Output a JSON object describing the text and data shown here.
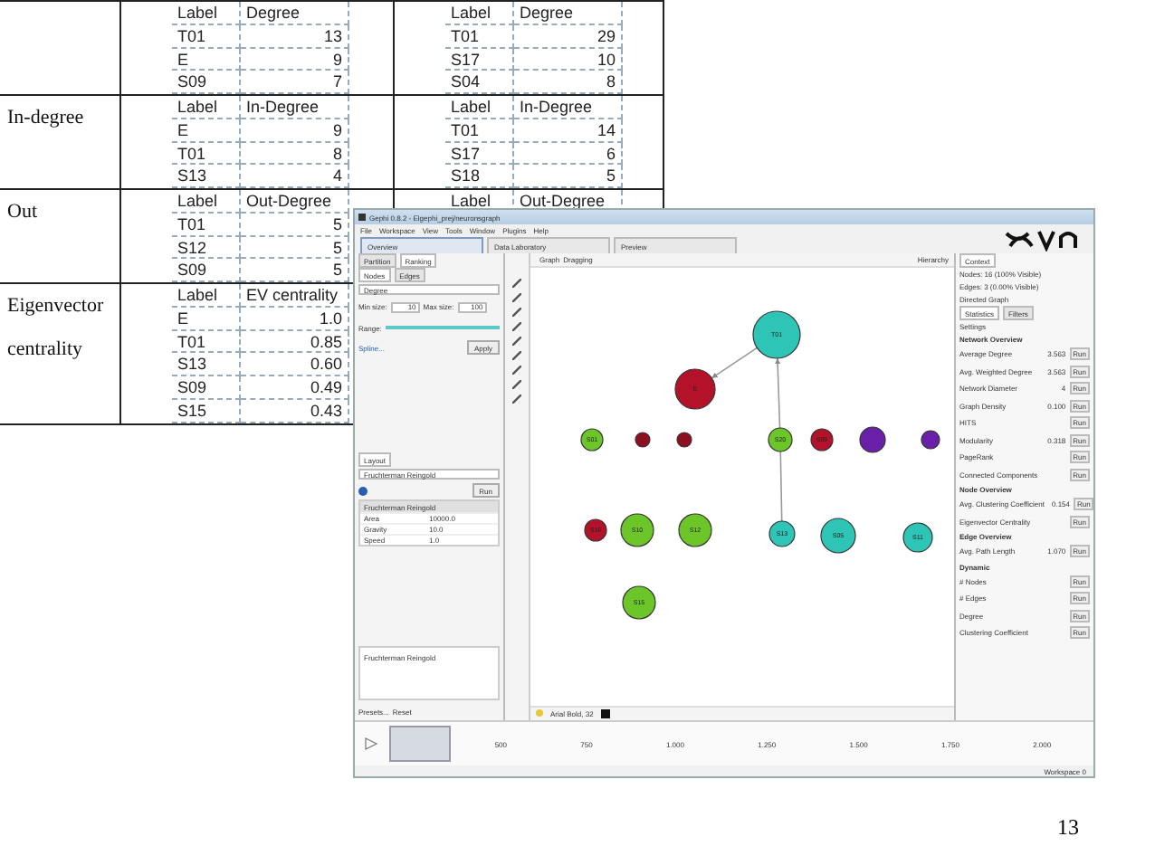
{
  "table": {
    "rows": [
      {
        "left": {
          "columns": [
            "Label",
            "Degree"
          ],
          "rows": [
            [
              "T01",
              "13"
            ],
            [
              "E",
              "9"
            ],
            [
              "S09",
              "7"
            ]
          ]
        },
        "right": {
          "columns": [
            "Label",
            "Degree"
          ],
          "rows": [
            [
              "T01",
              "29"
            ],
            [
              "S17",
              "10"
            ],
            [
              "S04",
              "8"
            ]
          ]
        }
      },
      {
        "metric": "In-degree",
        "left": {
          "columns": [
            "Label",
            "In-Degree"
          ],
          "rows": [
            [
              "E",
              "9"
            ],
            [
              "T01",
              "8"
            ],
            [
              "S13",
              "4"
            ]
          ]
        },
        "right": {
          "columns": [
            "Label",
            "In-Degree"
          ],
          "rows": [
            [
              "T01",
              "14"
            ],
            [
              "S17",
              "6"
            ],
            [
              "S18",
              "5"
            ]
          ]
        }
      },
      {
        "metric": "Out",
        "left": {
          "columns": [
            "Label",
            "Out-Degree"
          ],
          "rows": [
            [
              "T01",
              "5"
            ],
            [
              "S12",
              "5"
            ],
            [
              "S09",
              "5"
            ]
          ]
        },
        "right": {
          "columns": [
            "Label",
            "Out-Degree"
          ]
        }
      },
      {
        "metric": "Eigenvector centrality",
        "left": {
          "columns": [
            "Label",
            "EV centrality"
          ],
          "rows": [
            [
              "E",
              "1.0"
            ],
            [
              "T01",
              "0.85"
            ],
            [
              "S13",
              "0.60"
            ],
            [
              "S09",
              "0.49"
            ],
            [
              "S15",
              "0.43"
            ]
          ]
        }
      }
    ]
  },
  "gephi": {
    "title": "Gephi 0.8.2 - Elgephi_prej/neuronsgraph",
    "menu": [
      "File",
      "Workspace",
      "View",
      "Tools",
      "Window",
      "Plugins",
      "Help"
    ],
    "tabs": [
      {
        "label": "Overview",
        "selected": true
      },
      {
        "label": "Data Laboratory",
        "selected": false
      },
      {
        "label": "Preview",
        "selected": false
      }
    ],
    "left_panel": {
      "tabs": [
        {
          "label": "Partition",
          "selected": false
        },
        {
          "label": "Ranking",
          "selected": true
        }
      ],
      "subtabs": [
        {
          "label": "Nodes",
          "selected": true
        },
        {
          "label": "Edges",
          "selected": false
        }
      ],
      "parameter": "Degree",
      "min_label": "Min size:",
      "min_value": "10",
      "max_label": "Max size:",
      "max_value": "100",
      "range_label": "Range:",
      "range": {
        "level": 1
      },
      "spline": "Spline...",
      "apply": "Apply",
      "layout_tab": "Layout",
      "layout_algorithm": "Fruchterman Reingold",
      "run": "Run",
      "properties_title": "Fruchterman Reingold",
      "properties": [
        {
          "name": "Area",
          "value": "10000.0"
        },
        {
          "name": "Gravity",
          "value": "10.0"
        },
        {
          "name": "Speed",
          "value": "1.0"
        }
      ],
      "description_title": "Fruchterman Reingold",
      "presets": "Presets...",
      "reset": "Reset"
    },
    "graph": {
      "tab": "Graph",
      "mode": "Dragging",
      "hierarchy": "Hierarchy",
      "font": "Arial Bold, 32",
      "nodes": [
        {
          "label": "T01",
          "color": "#2ec4b6"
        },
        {
          "label": "E",
          "color": "#b3122a"
        },
        {
          "label": "S01",
          "color": "#6cc62a"
        },
        {
          "color": "#8e1020"
        },
        {
          "color": "#8e1020"
        },
        {
          "label": "S20",
          "color": "#6cc62a"
        },
        {
          "label": "S09",
          "color": "#b3122a"
        },
        {
          "color": "#6a1fa8"
        },
        {
          "color": "#6a1fa8"
        },
        {
          "label": "S16",
          "color": "#b3122a"
        },
        {
          "label": "S10",
          "color": "#6cc62a"
        },
        {
          "label": "S12",
          "color": "#6cc62a"
        },
        {
          "label": "S13",
          "color": "#2ec4b6"
        },
        {
          "label": "S05",
          "color": "#2ec4b6"
        },
        {
          "label": "S11",
          "color": "#2ec4b6"
        },
        {
          "label": "S15",
          "color": "#6cc62a"
        }
      ]
    },
    "right_panel": {
      "context_tab": "Context",
      "nodes": "Nodes: 16 (100% Visible)",
      "edges": "Edges: 3 (0.00% Visible)",
      "graph_type": "Directed Graph",
      "tabs": [
        {
          "label": "Statistics",
          "selected": true
        },
        {
          "label": "Filters",
          "selected": false
        }
      ],
      "settings": "Settings",
      "groups": [
        {
          "title": "Network Overview",
          "items": [
            {
              "name": "Average Degree",
              "value": "3.563",
              "run": "Run"
            },
            {
              "name": "Avg. Weighted Degree",
              "value": "3.563",
              "run": "Run"
            },
            {
              "name": "Network Diameter",
              "value": "4",
              "run": "Run"
            },
            {
              "name": "Graph Density",
              "value": "0.100",
              "run": "Run"
            },
            {
              "name": "HITS",
              "run": "Run"
            },
            {
              "name": "Modularity",
              "value": "0.318",
              "run": "Run"
            },
            {
              "name": "PageRank",
              "run": "Run"
            },
            {
              "name": "Connected Components",
              "run": "Run"
            }
          ]
        },
        {
          "title": "Node Overview",
          "items": [
            {
              "name": "Avg. Clustering Coefficient",
              "value": "0.154",
              "run": "Run"
            },
            {
              "name": "Eigenvector Centrality",
              "run": "Run"
            }
          ]
        },
        {
          "title": "Edge Overview",
          "items": [
            {
              "name": "Avg. Path Length",
              "value": "1.070",
              "run": "Run"
            }
          ]
        },
        {
          "title": "Dynamic",
          "items": [
            {
              "name": "# Nodes",
              "run": "Run"
            },
            {
              "name": "# Edges",
              "run": "Run"
            },
            {
              "name": "Degree",
              "run": "Run"
            },
            {
              "name": "Clustering Coefficient",
              "run": "Run"
            }
          ]
        }
      ]
    },
    "timeline": {
      "ticks": [
        "500",
        "750",
        "1.000",
        "1.250",
        "1.500",
        "1.750",
        "2.000"
      ]
    },
    "status": "Workspace 0"
  },
  "page_number": "13"
}
